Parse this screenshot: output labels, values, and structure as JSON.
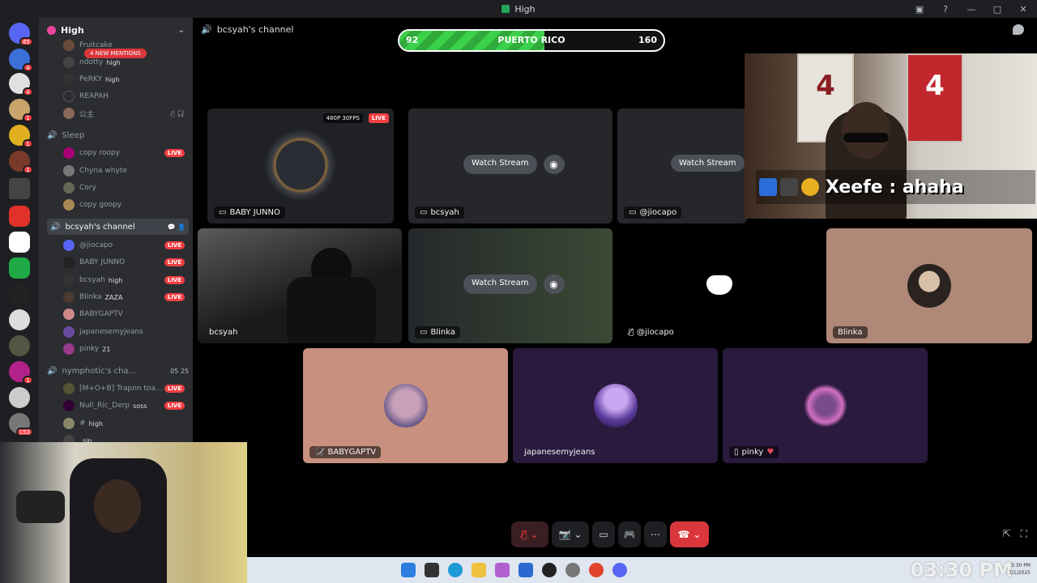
{
  "window": {
    "title": "High"
  },
  "server": {
    "name": "High",
    "mention_pill": "4 NEW MENTIONS"
  },
  "rail_badges": [
    "65",
    "4",
    "4",
    "1",
    "1",
    "1",
    "1",
    "153"
  ],
  "channels": {
    "top_users": [
      {
        "name": "Fruitcake",
        "status": ""
      },
      {
        "name": "ndotty",
        "status": "high"
      },
      {
        "name": "PeRKY",
        "status": "high"
      },
      {
        "name": "REAPAH",
        "status": ""
      },
      {
        "name": "公主",
        "status": ""
      }
    ],
    "sleep": {
      "label": "Sleep",
      "users": [
        {
          "name": "copy roopy",
          "live": "LIVE"
        },
        {
          "name": "Chyna whyte",
          "live": ""
        },
        {
          "name": "Cory",
          "live": ""
        },
        {
          "name": "copy goopy",
          "live": ""
        }
      ]
    },
    "bcsyah": {
      "label": "bcsyah's channel",
      "users": [
        {
          "name": "@jiocapo",
          "status": "",
          "live": "LIVE"
        },
        {
          "name": "BABY JUNNO",
          "status": "",
          "live": "LIVE"
        },
        {
          "name": "bcsyah",
          "status": "high",
          "live": "LIVE"
        },
        {
          "name": "Blinka",
          "status": "ZAZA",
          "live": "LIVE"
        },
        {
          "name": "BABYGAPTV",
          "status": "",
          "live": ""
        },
        {
          "name": "japanesemyjeans",
          "status": "",
          "live": ""
        },
        {
          "name": "pinky",
          "status": "21",
          "live": ""
        }
      ]
    },
    "nymphotic": {
      "label": "nymphotic's cha...",
      "count_a": "05",
      "count_b": "25",
      "users": [
        {
          "name": "[M+O+B] Trapnn toa...",
          "status": "",
          "live": "LIVE"
        },
        {
          "name": "Null_Ric_Derp",
          "status": "soss",
          "live": "LIVE"
        },
        {
          "name": "#",
          "status": "high",
          "live": ""
        },
        {
          "name": "",
          "status": "sip",
          "live": ""
        }
      ]
    }
  },
  "stage": {
    "header": "bcsyah's channel",
    "watch_label": "Watch Stream",
    "tiles": {
      "baby_junno": {
        "name": "BABY JUNNO",
        "res": "480P 30FPS",
        "live": "LIVE"
      },
      "bcsyah_stream": {
        "name": "bcsyah"
      },
      "jiocapo_stream": {
        "name": "@jiocapo"
      },
      "bcsyah_cam": {
        "name": "bcsyah"
      },
      "blinka_stream": {
        "name": "Blinka"
      },
      "jiocapo_voice": {
        "name": "@jiocapo"
      },
      "blinka_voice": {
        "name": "Blinka"
      },
      "babygaptv": {
        "name": "BABYGAPTV"
      },
      "japanesemyjeans": {
        "name": "japanesemyjeans"
      },
      "pinky": {
        "name": "pinky"
      }
    }
  },
  "overlay": {
    "score_left": "92",
    "score_title": "PUERTO RICO",
    "score_right": "160",
    "score_fill_fraction": 0.55,
    "chat_line": "Xeefe : ahaha",
    "jersey_number": "4"
  },
  "taskbar": {
    "clock": "03:30 PM",
    "tray_time": "3:30 PM",
    "tray_date": "7/1/2025"
  },
  "colors": {
    "accent": "#5865f2",
    "live": "#f23f43",
    "hangup": "#da373c",
    "score_green": "#3bd14a"
  }
}
